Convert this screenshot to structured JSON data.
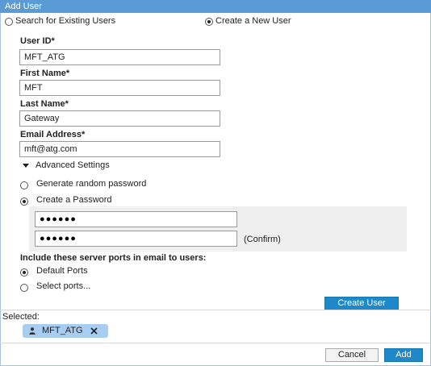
{
  "window": {
    "title": "Add User"
  },
  "mode": {
    "search_label": "Search for Existing Users",
    "create_label": "Create a New User",
    "selected": "create"
  },
  "form": {
    "user_id": {
      "label": "User ID*",
      "value": "MFT_ATG"
    },
    "first_name": {
      "label": "First Name*",
      "value": "MFT"
    },
    "last_name": {
      "label": "Last Name*",
      "value": "Gateway"
    },
    "email": {
      "label": "Email Address*",
      "value": "mft@atg.com"
    }
  },
  "advanced": {
    "label": "Advanced Settings",
    "random_label": "Generate random password",
    "create_pw_label": "Create a Password",
    "password_mask": "●●●●●●",
    "confirm_mask": "●●●●●●",
    "confirm_label": "(Confirm)"
  },
  "ports": {
    "heading": "Include these server ports in email to users:",
    "default_label": "Default Ports",
    "select_label": "Select ports..."
  },
  "create_user_button": "Create User",
  "selected_section": {
    "label": "Selected:",
    "chips": [
      {
        "label": "MFT_ATG"
      }
    ]
  },
  "footer": {
    "cancel": "Cancel",
    "add": "Add"
  },
  "colors": {
    "accent": "#1e88c8",
    "titlebar": "#5b9bd5",
    "chip": "#a9cdf0"
  }
}
